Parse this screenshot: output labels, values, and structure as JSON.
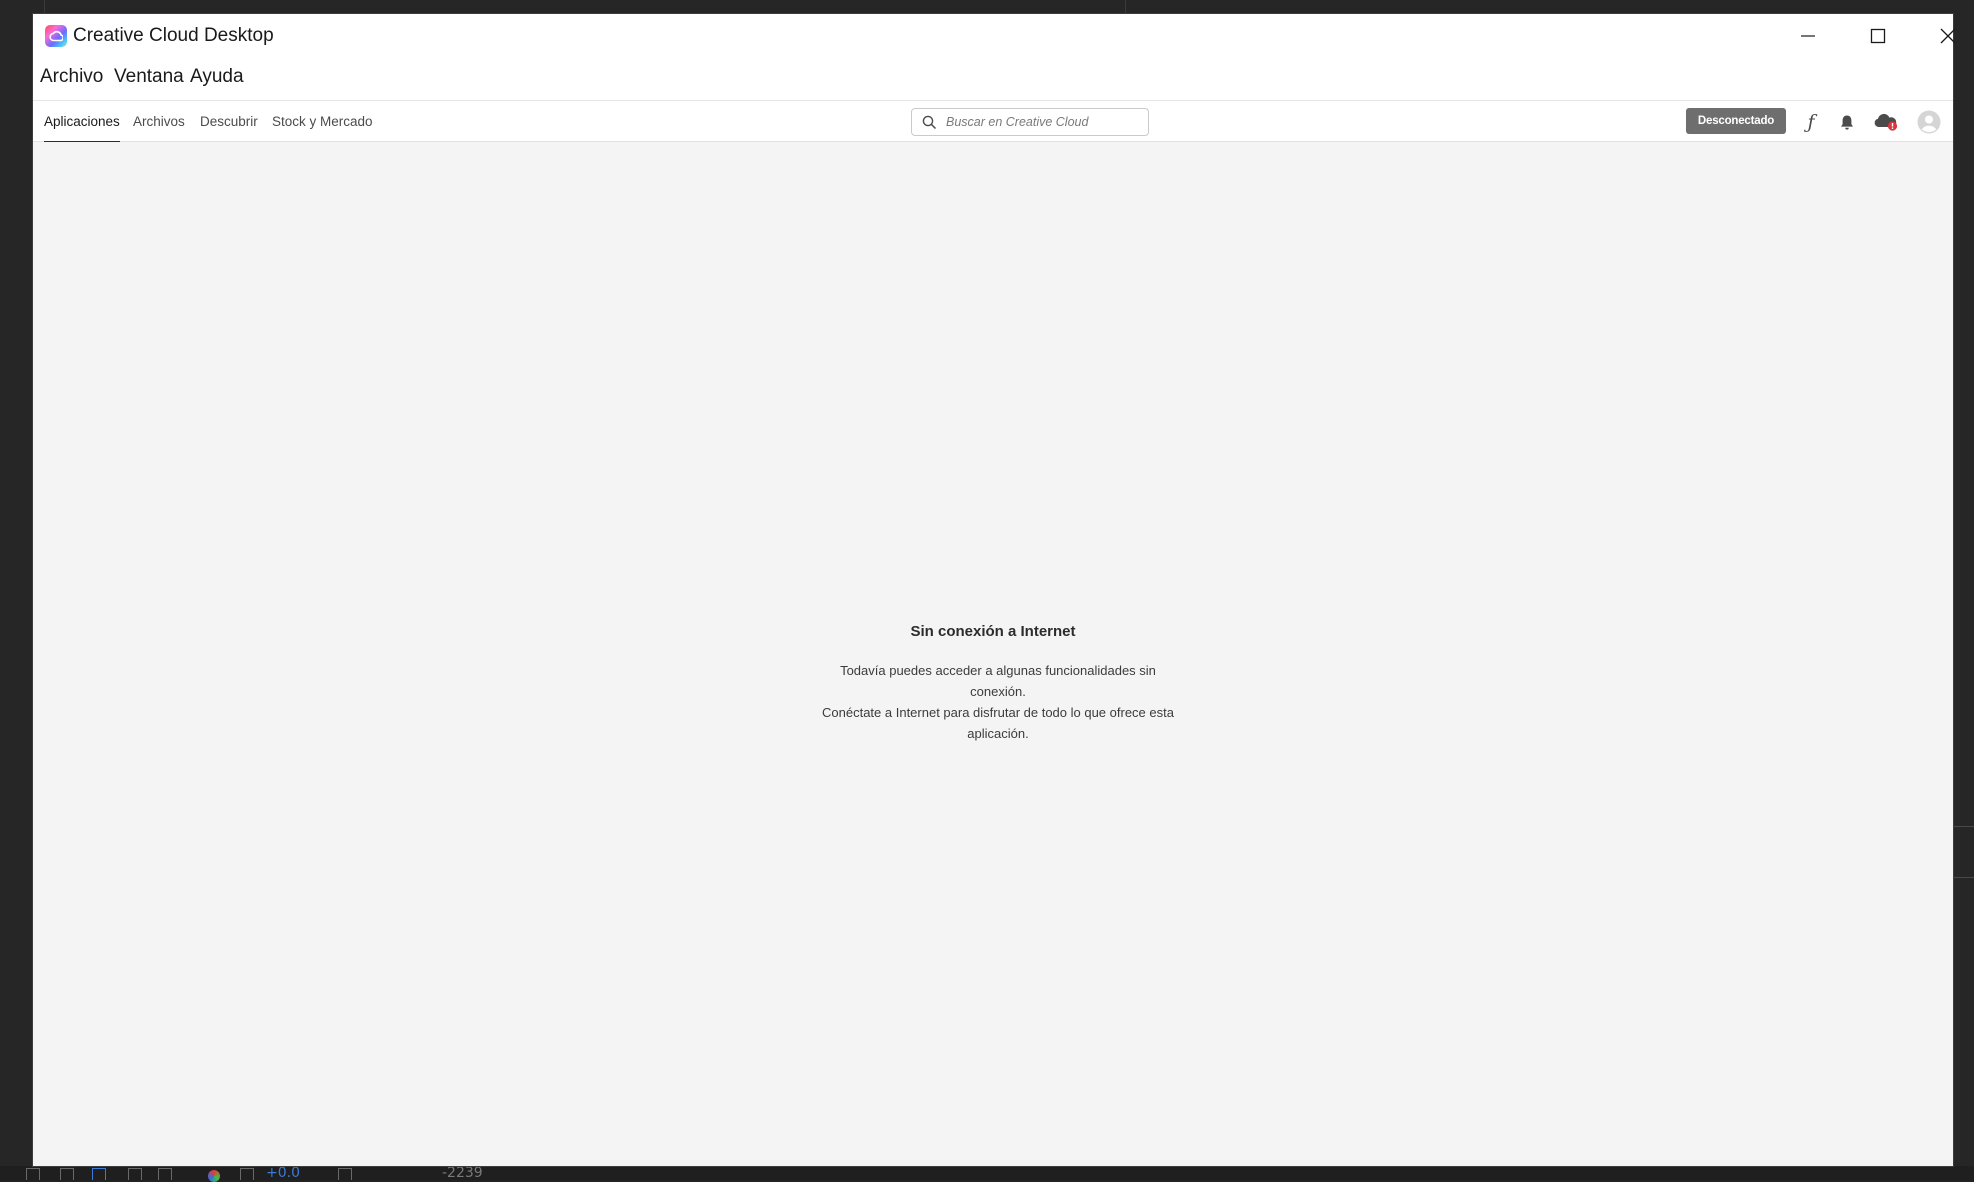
{
  "window": {
    "title": "Creative Cloud Desktop",
    "logo_icon": "creative-cloud-logo"
  },
  "menubar": {
    "items": [
      "Archivo",
      "Ventana",
      "Ayuda"
    ]
  },
  "nav": {
    "tabs": [
      {
        "label": "Aplicaciones",
        "active": true
      },
      {
        "label": "Archivos",
        "active": false
      },
      {
        "label": "Descubrir",
        "active": false
      },
      {
        "label": "Stock y Mercado",
        "active": false
      }
    ],
    "search": {
      "placeholder": "Buscar en Creative Cloud",
      "value": ""
    },
    "status_label": "Desconectado",
    "icons": [
      "fonts-icon",
      "bell-icon",
      "cloud-sync-error-icon",
      "user-avatar-icon"
    ]
  },
  "main": {
    "title": "Sin conexión a Internet",
    "lines": [
      "Todavía puedes acceder a algunas funcionalidades sin conexión.",
      "Conéctate a Internet para disfrutar de todo lo que ofrece esta",
      "aplicación."
    ]
  },
  "background": {
    "bottom_values": [
      "+0.0",
      "-2239"
    ]
  },
  "colors": {
    "status_button": "#6e6e6e",
    "alert_badge": "#d7373f",
    "window_bg": "#f4f4f4",
    "chrome_bg": "#ffffff"
  }
}
